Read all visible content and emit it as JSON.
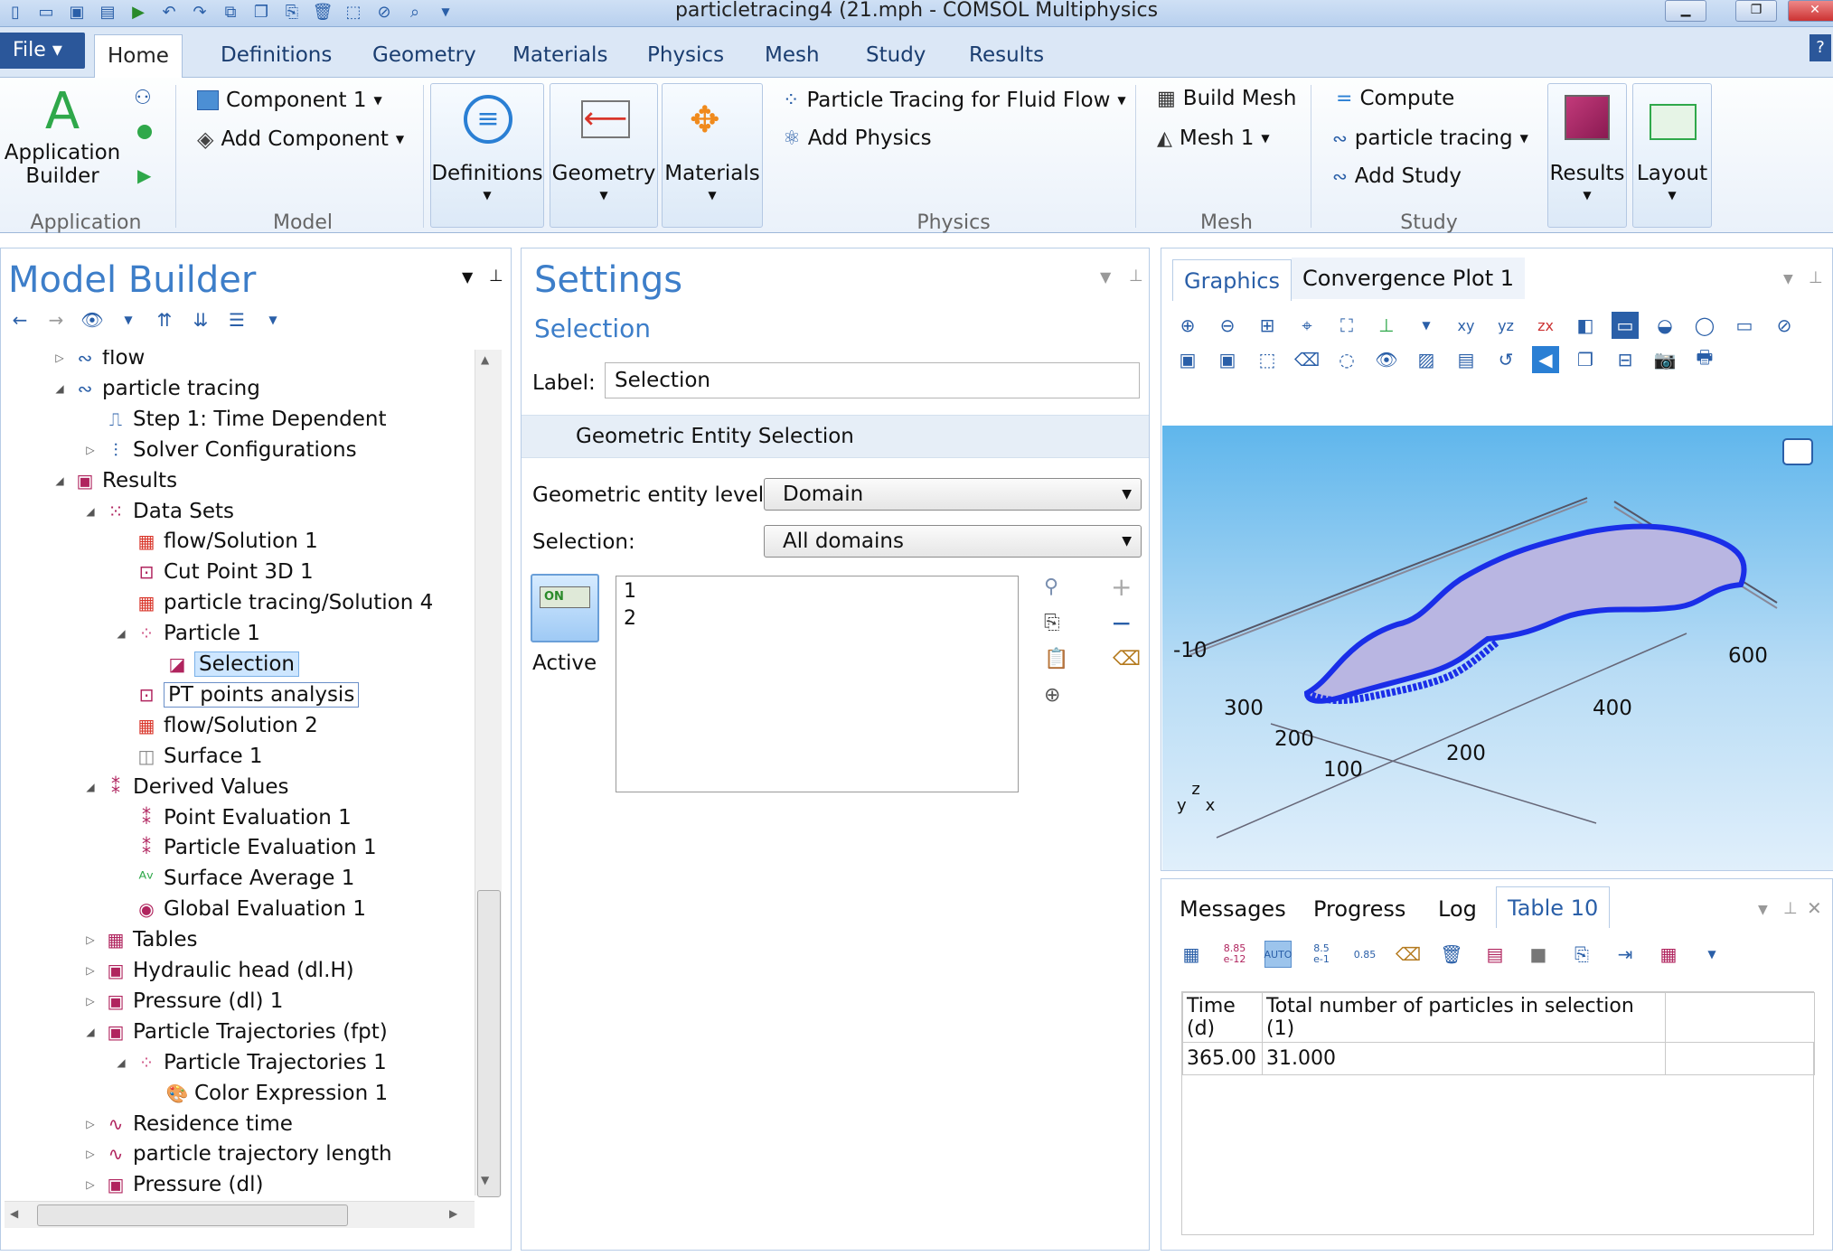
{
  "window": {
    "title": "particletracing4 (21.mph - COMSOL Multiphysics"
  },
  "ribbon": {
    "file_label": "File",
    "tabs": [
      "Home",
      "Definitions",
      "Geometry",
      "Materials",
      "Physics",
      "Mesh",
      "Study",
      "Results"
    ],
    "active_tab": "Home",
    "application": {
      "builder_label": "Application\nBuilder",
      "builder_line1": "Application",
      "builder_line2": "Builder",
      "group_label": "Application"
    },
    "model": {
      "component": "Component 1",
      "add_component": "Add Component",
      "group_label": "Model"
    },
    "definitions_label": "Definitions",
    "geometry_label": "Geometry",
    "materials_label": "Materials",
    "physics": {
      "interface": "Particle Tracing for Fluid Flow",
      "add_physics": "Add Physics",
      "group_label": "Physics"
    },
    "mesh": {
      "build_mesh": "Build Mesh",
      "mesh1": "Mesh 1",
      "group_label": "Mesh"
    },
    "study": {
      "compute": "Compute",
      "study_name": "particle tracing",
      "add_study": "Add Study",
      "group_label": "Study"
    },
    "results_label": "Results",
    "layout_label": "Layout",
    "help": "?"
  },
  "model_builder": {
    "title": "Model Builder",
    "tree": [
      {
        "label": "flow",
        "indent": 0,
        "twisty": "collapsed",
        "icon": "study-icon"
      },
      {
        "label": "particle tracing",
        "indent": 0,
        "twisty": "expanded",
        "icon": "study-icon"
      },
      {
        "label": "Step 1: Time Dependent",
        "indent": 1,
        "twisty": "",
        "icon": "time-step-icon"
      },
      {
        "label": "Solver Configurations",
        "indent": 1,
        "twisty": "collapsed",
        "icon": "solver-icon"
      },
      {
        "label": "Results",
        "indent": 0,
        "twisty": "expanded",
        "icon": "results-icon"
      },
      {
        "label": "Data Sets",
        "indent": 1,
        "twisty": "expanded",
        "icon": "datasets-icon"
      },
      {
        "label": "flow/Solution 1",
        "indent": 2,
        "twisty": "",
        "icon": "solution-icon"
      },
      {
        "label": "Cut Point 3D 1",
        "indent": 2,
        "twisty": "",
        "icon": "cutpoint-icon"
      },
      {
        "label": "particle tracing/Solution 4",
        "indent": 2,
        "twisty": "",
        "icon": "solution-icon"
      },
      {
        "label": "Particle 1",
        "indent": 2,
        "twisty": "expanded",
        "icon": "particle-icon"
      },
      {
        "label": "Selection",
        "indent": 3,
        "twisty": "",
        "icon": "selection-icon",
        "selected": true
      },
      {
        "label": "PT points analysis",
        "indent": 2,
        "twisty": "",
        "icon": "cutpoint-icon",
        "focused": true
      },
      {
        "label": "flow/Solution 2",
        "indent": 2,
        "twisty": "",
        "icon": "solution-icon"
      },
      {
        "label": "Surface 1",
        "indent": 2,
        "twisty": "",
        "icon": "surface-icon"
      },
      {
        "label": "Derived Values",
        "indent": 1,
        "twisty": "expanded",
        "icon": "derived-icon"
      },
      {
        "label": "Point Evaluation 1",
        "indent": 2,
        "twisty": "",
        "icon": "derived-icon"
      },
      {
        "label": "Particle Evaluation 1",
        "indent": 2,
        "twisty": "",
        "icon": "derived-icon"
      },
      {
        "label": "Surface Average 1",
        "indent": 2,
        "twisty": "",
        "icon": "average-icon"
      },
      {
        "label": "Global Evaluation 1",
        "indent": 2,
        "twisty": "",
        "icon": "global-icon"
      },
      {
        "label": "Tables",
        "indent": 1,
        "twisty": "collapsed",
        "icon": "tables-icon"
      },
      {
        "label": "Hydraulic head (dl.H)",
        "indent": 1,
        "twisty": "collapsed",
        "icon": "plotgroup-icon"
      },
      {
        "label": "Pressure (dl) 1",
        "indent": 1,
        "twisty": "collapsed",
        "icon": "plotgroup-icon"
      },
      {
        "label": "Particle Trajectories (fpt)",
        "indent": 1,
        "twisty": "expanded",
        "icon": "plotgroup-icon"
      },
      {
        "label": "Particle Trajectories 1",
        "indent": 2,
        "twisty": "expanded",
        "icon": "trajectory-icon"
      },
      {
        "label": "Color Expression 1",
        "indent": 3,
        "twisty": "",
        "icon": "color-expression-icon"
      },
      {
        "label": "Residence time",
        "indent": 1,
        "twisty": "collapsed",
        "icon": "plot1d-icon"
      },
      {
        "label": "particle trajectory length",
        "indent": 1,
        "twisty": "collapsed",
        "icon": "plot1d-icon"
      },
      {
        "label": "Pressure (dl)",
        "indent": 1,
        "twisty": "collapsed",
        "icon": "plotgroup-icon"
      }
    ]
  },
  "settings": {
    "title": "Settings",
    "subtitle": "Selection",
    "label_caption": "Label:",
    "label_value": "Selection",
    "section_title": "Geometric Entity Selection",
    "entity_level_caption": "Geometric entity level:",
    "entity_level_value": "Domain",
    "selection_caption": "Selection:",
    "selection_value": "All domains",
    "toggle_label": "ON",
    "active_label": "Active",
    "selection_items": [
      "1",
      "2"
    ]
  },
  "graphics": {
    "tabs": [
      "Graphics",
      "Convergence Plot 1"
    ],
    "active_tab": "Graphics",
    "axis_labels": [
      "-10",
      "300",
      "200",
      "100",
      "600",
      "400",
      "200"
    ],
    "triad": {
      "y": "y",
      "z": "z",
      "x": "x"
    }
  },
  "messages": {
    "tabs": [
      "Messages",
      "Progress",
      "Log",
      "Table 10"
    ],
    "active_tab": "Table 10",
    "table": {
      "headers": [
        "Time (d)",
        "Total number of particles in selection (1)"
      ],
      "rows": [
        [
          "365.00",
          "31.000"
        ]
      ]
    },
    "toolbar_labels": {
      "num_fmt_1": "8.85\ne-12",
      "auto": "AUTO",
      "num_fmt_2": "8.5\ne-1",
      "num_fmt_3": "0.85"
    }
  }
}
